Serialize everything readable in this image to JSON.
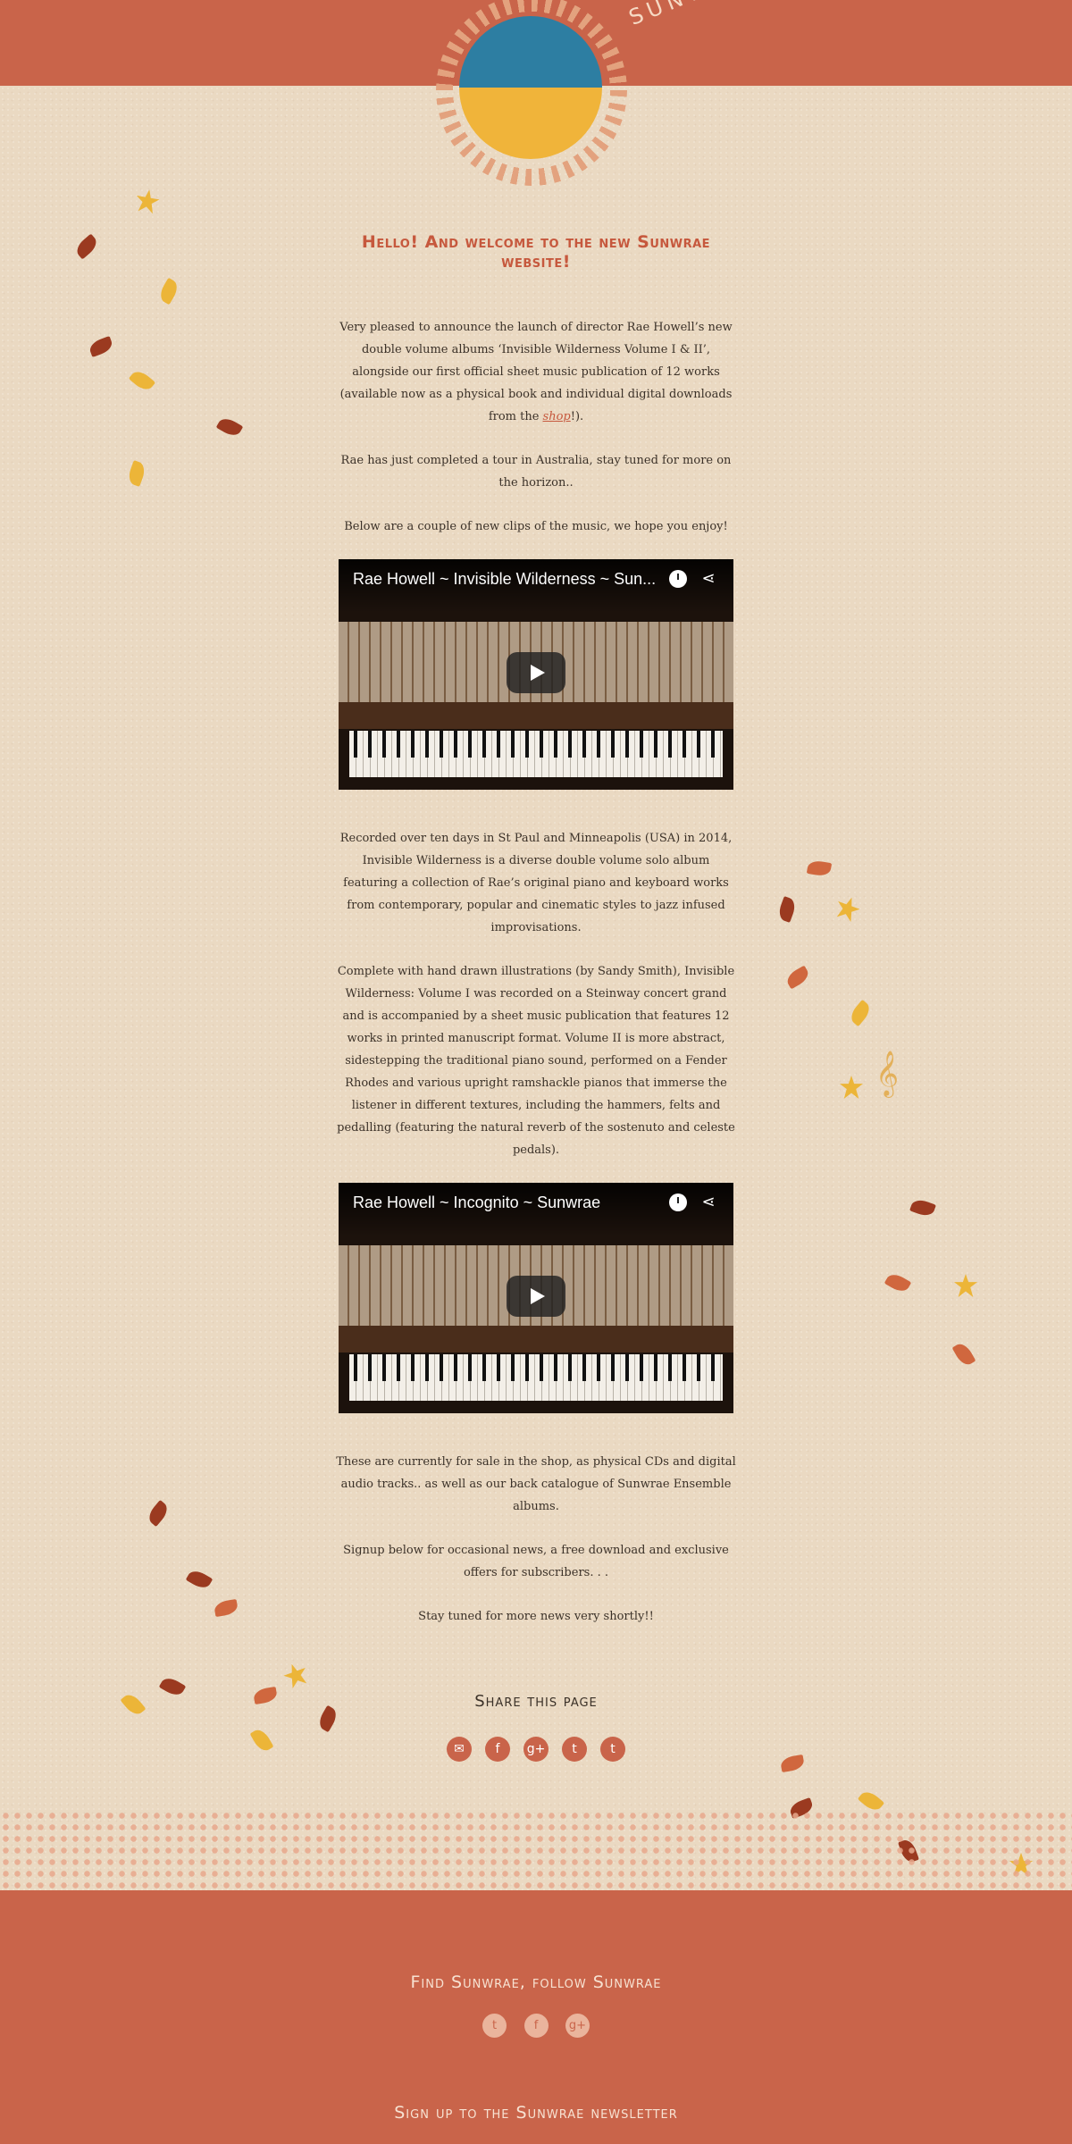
{
  "header": {
    "brand": "SUNWRAE"
  },
  "main": {
    "headline": "Hello! And welcome to the new Sunwrae website!",
    "intro_before_link": "Very pleased to announce the launch of director Rae Howell’s new double volume albums ‘Invisible Wilderness Volume I & II’, alongside our first official sheet music publication of 12 works (available now as a physical book and individual digital downloads from the ",
    "intro_link": "shop",
    "intro_after_link": "!).",
    "tour": "Rae has just completed a tour in Australia, stay tuned for more on the horizon..",
    "clips_intro": "Below are a couple of new clips of the music, we hope you enjoy!",
    "video1_title": "Rae Howell ~ Invisible Wilderness ~ Sun...",
    "recorded": "Recorded over ten days in St Paul and Minneapolis (USA) in 2014, Invisible Wilderness is a diverse double volume solo album featuring a collection of Rae’s original piano and keyboard works from contemporary, popular and cinematic styles to jazz infused improvisations.",
    "complete": "Complete with hand drawn illustrations (by Sandy Smith), Invisible Wilderness: Volume I was recorded on a Steinway concert grand and is accompanied by a sheet music publication that features 12 works in printed manuscript format. Volume II is more abstract, sidestepping the traditional piano sound, performed on a Fender Rhodes and various upright ramshackle pianos that immerse the listener in different textures, including the hammers, felts and pedalling (featuring the natural reverb of the sostenuto and celeste pedals).",
    "video2_title": "Rae Howell ~ Incognito ~ Sunwrae",
    "for_sale": "These are currently for sale in the shop, as physical CDs and digital audio tracks.. as well as our back catalogue of Sunwrae Ensemble albums.",
    "signup": "Signup below for occasional news, a free download and exclusive offers for subscribers. . .",
    "stay_tuned": "Stay tuned for more news very shortly!!"
  },
  "share": {
    "title": "Share this page",
    "icons": [
      "email-icon",
      "facebook-icon",
      "google-plus-icon",
      "twitter-icon",
      "tumblr-icon"
    ],
    "glyphs": [
      "✉",
      "f",
      "g+",
      "t",
      "t"
    ]
  },
  "footer": {
    "follow_title": "Find Sunwrae, follow Sunwrae",
    "follow_icons": [
      "twitter-icon",
      "facebook-icon",
      "google-plus-icon"
    ],
    "follow_glyphs": [
      "t",
      "f",
      "g+"
    ],
    "newsletter_title": "Sign up to the Sunwrae newsletter"
  },
  "colors": {
    "accent": "#c9644a",
    "heading": "#c6583d",
    "background": "#ead9c2",
    "logo_blue": "#2d7ea2",
    "logo_yellow": "#f0b43a"
  }
}
